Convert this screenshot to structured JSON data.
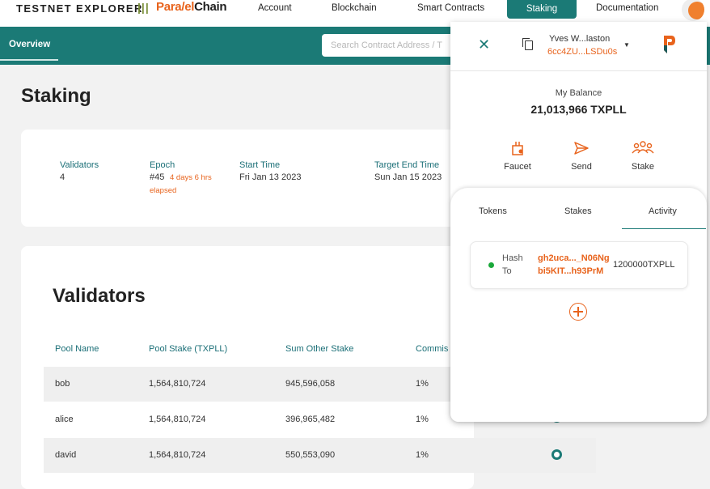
{
  "topnav": {
    "brand": "TESTNET EXPLORER",
    "separator": "|||",
    "logo_part1": "Para",
    "logo_part2": "/el",
    "logo_part3": "Chain",
    "items": [
      "Account",
      "Blockchain",
      "Smart Contracts",
      "Staking",
      "Documentation"
    ],
    "active": "Staking"
  },
  "subnav": {
    "tab": "Overview",
    "search_placeholder": "Search Contract Address / T"
  },
  "page": {
    "title": "Staking"
  },
  "stats": {
    "validators_label": "Validators",
    "validators_value": "4",
    "epoch_label": "Epoch",
    "epoch_value": "#45",
    "epoch_note_1": "4 days 6 hrs",
    "epoch_note_2": "elapsed",
    "start_label": "Start Time",
    "start_value": "Fri Jan 13 2023",
    "end_label": "Target End Time",
    "end_value": "Sun Jan 15 2023"
  },
  "validators": {
    "title": "Validators",
    "columns": [
      "Pool Name",
      "Pool Stake (TXPLL)",
      "Sum Other Stake",
      "Commis"
    ],
    "rows": [
      {
        "name": "bob",
        "stake": "1,564,810,724",
        "other": "945,596,058",
        "commission": "1%"
      },
      {
        "name": "alice",
        "stake": "1,564,810,724",
        "other": "396,965,482",
        "commission": "1%"
      },
      {
        "name": "david",
        "stake": "1,564,810,724",
        "other": "550,553,090",
        "commission": "1%"
      }
    ]
  },
  "wallet": {
    "user_name": "Yves W...laston",
    "address": "6cc4ZU...LSDu0s",
    "balance_label": "My Balance",
    "balance": "21,013,966 TXPLL",
    "actions": [
      "Faucet",
      "Send",
      "Stake"
    ],
    "tabs": [
      "Tokens",
      "Stakes",
      "Activity"
    ],
    "active_tab": "Activity",
    "activity": {
      "hash_label": "Hash",
      "to_label": "To",
      "hash": "gh2uca..._N06Ng",
      "to": "bi5KIT...h93PrM",
      "amount": "1200000TXPLL"
    }
  },
  "colors": {
    "primary": "#1b7a76",
    "accent": "#e8631c",
    "status_ok": "#1aa83a"
  }
}
